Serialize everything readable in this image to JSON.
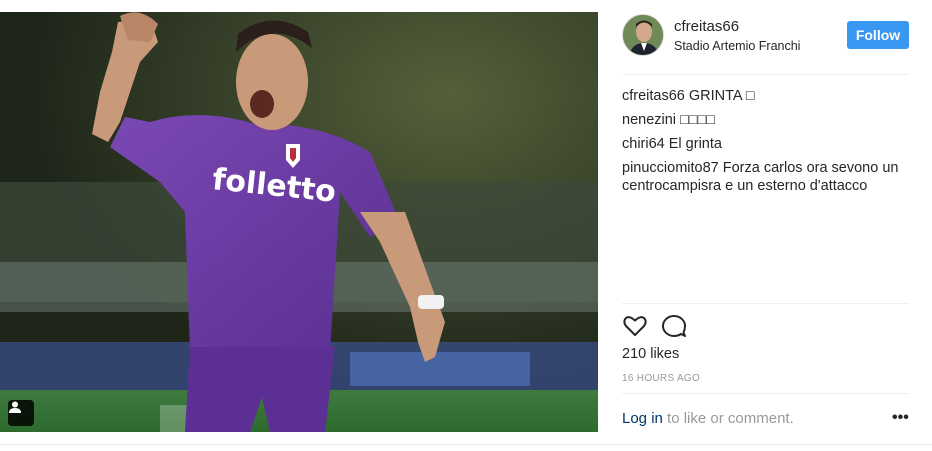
{
  "post_header": {
    "username": "cfreitas66",
    "location": "Stadio Artemio Franchi",
    "follow_label": "Follow"
  },
  "photo": {
    "jersey_text": "folletto",
    "tag_icon": "user-tag-icon"
  },
  "comments": [
    {
      "user": "cfreitas66",
      "text": "GRINTA □"
    },
    {
      "user": "nenezini",
      "text": "□□□□"
    },
    {
      "user": "chiri64",
      "text": "El grinta"
    },
    {
      "user": "pinucciomito87",
      "text": "Forza carlos ora sevono un centrocampisra e un esterno d'attacco"
    }
  ],
  "actions": {
    "like_icon": "heart-icon",
    "comment_icon": "comment-icon"
  },
  "likes_text": "210 likes",
  "time_text": "16 HOURS AGO",
  "login_prompt": {
    "link": "Log in",
    "rest": " to like or comment."
  },
  "more_label": "•••",
  "colors": {
    "follow_button": "#3897f0",
    "jersey": "#6b3aa0",
    "link": "#003569",
    "muted": "#999999"
  }
}
